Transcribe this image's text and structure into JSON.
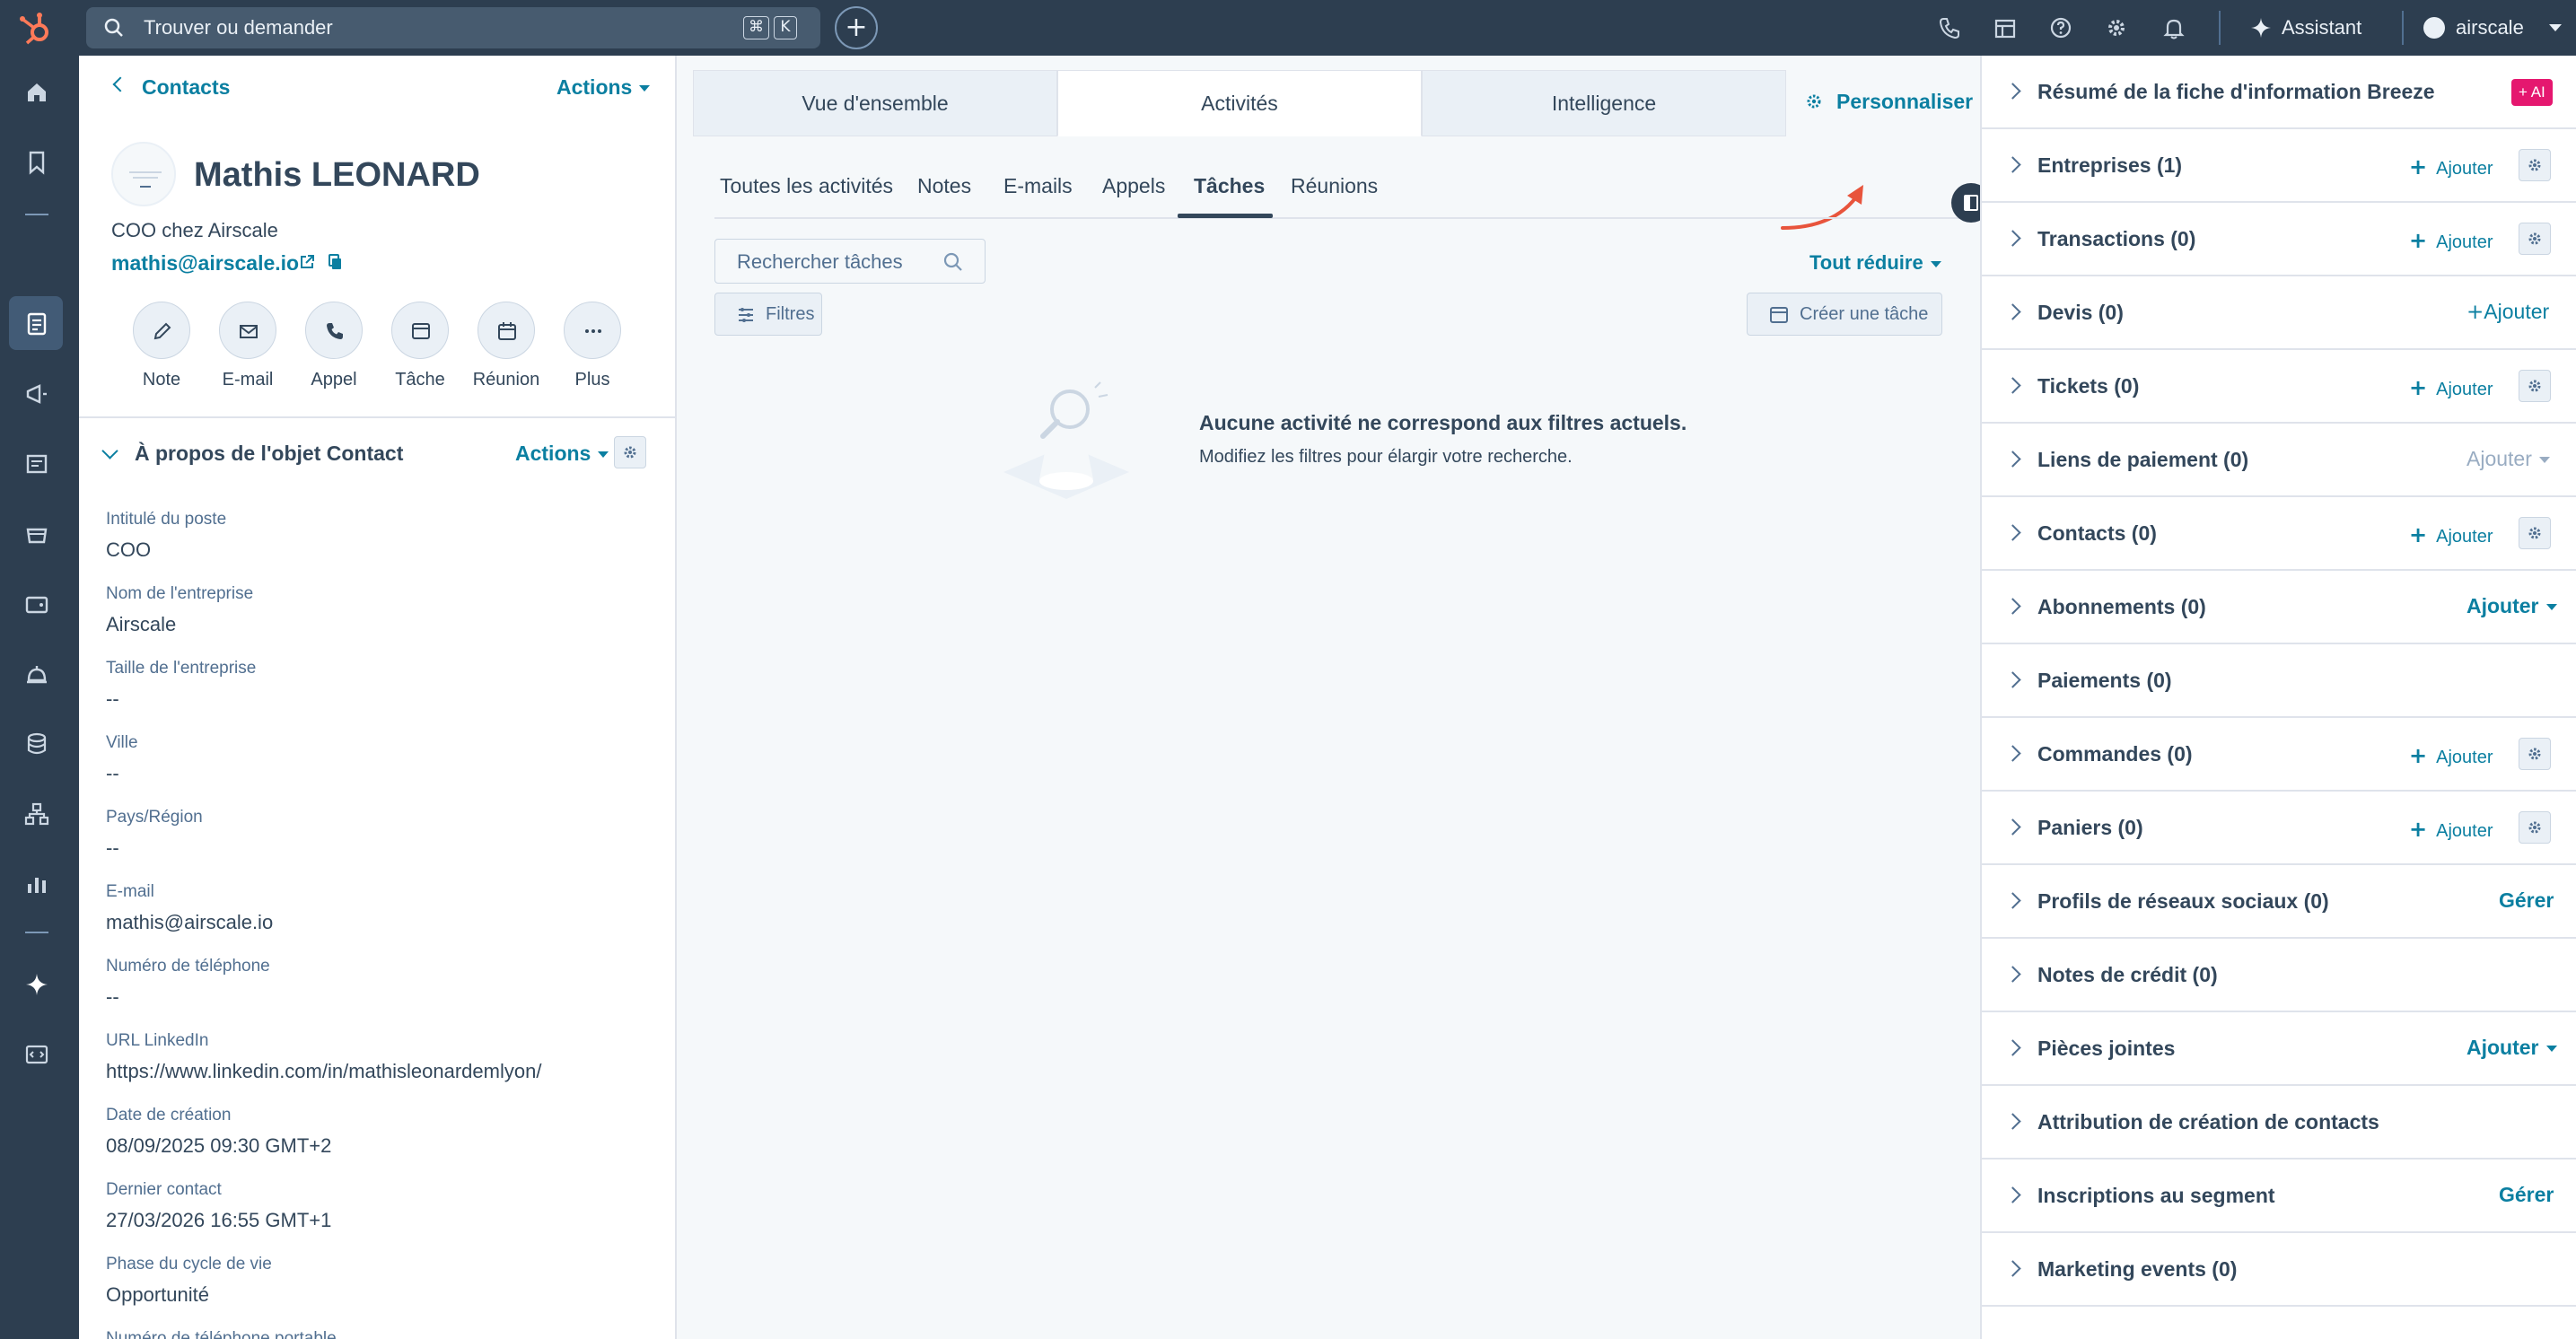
{
  "topbar": {
    "search_placeholder": "Trouver ou demander",
    "kbd_cmd": "⌘",
    "kbd_k": "K",
    "add_label": "+",
    "assistant_label": "Assistant",
    "account_label": "airscale",
    "icons": [
      "phone-icon",
      "marketplace-icon",
      "help-icon",
      "settings-icon",
      "notifications-icon"
    ]
  },
  "leftnav": {
    "icons": [
      "home-icon",
      "bookmark-icon",
      "contacts-icon",
      "marketing-icon",
      "content-icon",
      "commerce-icon",
      "sales-icon",
      "service-icon",
      "data-icon",
      "automation-icon",
      "reporting-icon",
      "breeze-icon",
      "developer-icon"
    ]
  },
  "left": {
    "back_label": "Contacts",
    "actions_label": "Actions",
    "name": "Mathis LEONARD",
    "subtitle": "COO chez Airscale",
    "email": "mathis@airscale.io",
    "buttons": [
      {
        "label": "Note",
        "icon": "pencil-icon"
      },
      {
        "label": "E-mail",
        "icon": "email-icon"
      },
      {
        "label": "Appel",
        "icon": "phone-icon"
      },
      {
        "label": "Tâche",
        "icon": "task-icon"
      },
      {
        "label": "Réunion",
        "icon": "calendar-icon"
      },
      {
        "label": "Plus",
        "icon": "more-icon"
      }
    ],
    "about_title": "À propos de l'objet Contact",
    "about_actions": "Actions",
    "properties": [
      {
        "label": "Intitulé du poste",
        "value": "COO"
      },
      {
        "label": "Nom de l'entreprise",
        "value": "Airscale"
      },
      {
        "label": "Taille de l'entreprise",
        "value": "--"
      },
      {
        "label": "Ville",
        "value": "--"
      },
      {
        "label": "Pays/Région",
        "value": "--"
      },
      {
        "label": "E-mail",
        "value": "mathis@airscale.io"
      },
      {
        "label": "Numéro de téléphone",
        "value": "--"
      },
      {
        "label": "URL LinkedIn",
        "value": "https://www.linkedin.com/in/mathisleonardemlyon/"
      },
      {
        "label": "Date de création",
        "value": "08/09/2025 09:30 GMT+2"
      },
      {
        "label": "Dernier contact",
        "value": "27/03/2026 16:55 GMT+1"
      },
      {
        "label": "Phase du cycle de vie",
        "value": "Opportunité"
      },
      {
        "label": "Numéro de téléphone portable",
        "value": ""
      }
    ]
  },
  "center": {
    "tabs": [
      "Vue d'ensemble",
      "Activités",
      "Intelligence"
    ],
    "active_tab": "Activités",
    "personaliser": "Personnaliser",
    "subtabs": [
      "Toutes les activités",
      "Notes",
      "E-mails",
      "Appels",
      "Tâches",
      "Réunions"
    ],
    "active_subtab": "Tâches",
    "search_placeholder": "Rechercher tâches",
    "tout_reduire": "Tout réduire",
    "filtres": "Filtres",
    "creer_tache": "Créer une tâche",
    "empty_title": "Aucune activité ne correspond aux filtres actuels.",
    "empty_sub": "Modifiez les filtres pour élargir votre recherche."
  },
  "right": {
    "ai_badge": "+ AI",
    "cards": [
      {
        "title": "Résumé de la fiche d'information Breeze",
        "action": "ai"
      },
      {
        "title": "Entreprises (1)",
        "action": "ajouter-gear",
        "action_label": "Ajouter"
      },
      {
        "title": "Transactions (0)",
        "action": "ajouter-gear",
        "action_label": "Ajouter"
      },
      {
        "title": "Devis (0)",
        "action": "ajouter-big",
        "action_label": "Ajouter"
      },
      {
        "title": "Tickets (0)",
        "action": "ajouter-gear",
        "action_label": "Ajouter"
      },
      {
        "title": "Liens de paiement (0)",
        "action": "ajouter-grey-dd",
        "action_label": "Ajouter"
      },
      {
        "title": "Contacts (0)",
        "action": "ajouter-gear",
        "action_label": "Ajouter"
      },
      {
        "title": "Abonnements (0)",
        "action": "ajouter-dd",
        "action_label": "Ajouter"
      },
      {
        "title": "Paiements (0)",
        "action": "none"
      },
      {
        "title": "Commandes (0)",
        "action": "ajouter-gear",
        "action_label": "Ajouter"
      },
      {
        "title": "Paniers (0)",
        "action": "ajouter-gear",
        "action_label": "Ajouter"
      },
      {
        "title": "Profils de réseaux sociaux (0)",
        "action": "gerer",
        "action_label": "Gérer"
      },
      {
        "title": "Notes de crédit (0)",
        "action": "none"
      },
      {
        "title": "Pièces jointes",
        "action": "ajouter-dd",
        "action_label": "Ajouter"
      },
      {
        "title": "Attribution de création de contacts",
        "action": "none"
      },
      {
        "title": "Inscriptions au segment",
        "action": "gerer",
        "action_label": "Gérer"
      },
      {
        "title": "Marketing events (0)",
        "action": "none"
      }
    ]
  },
  "colors": {
    "nav_bg": "#2d3e50",
    "link": "#0b7fa1",
    "text": "#33475b",
    "accent_arrow": "#e8543c",
    "ai_badge": "#e5176f"
  }
}
